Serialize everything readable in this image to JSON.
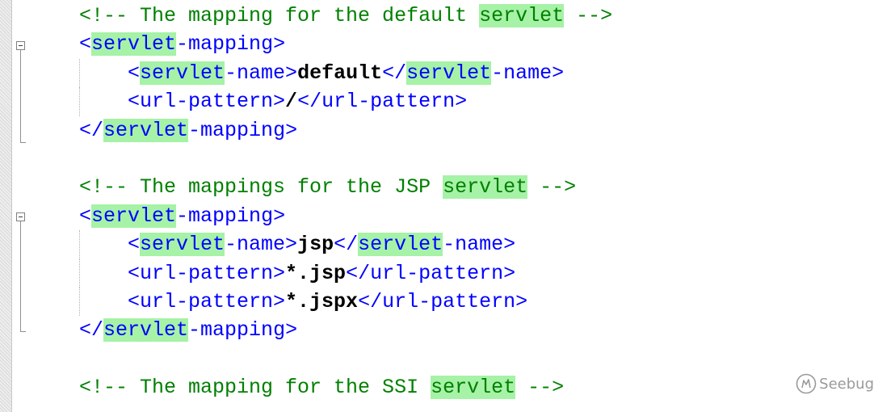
{
  "editor": {
    "lines": [
      [
        {
          "c": "comment",
          "t": "<!-- The mapping for the default "
        },
        {
          "c": "comment hl",
          "t": "servlet"
        },
        {
          "c": "comment",
          "t": " -->"
        }
      ],
      [
        {
          "c": "tag",
          "t": "<"
        },
        {
          "c": "tag hl",
          "t": "servlet"
        },
        {
          "c": "tag",
          "t": "-mapping>"
        }
      ],
      [
        {
          "c": "tag",
          "t": "    <"
        },
        {
          "c": "tag hl",
          "t": "servlet"
        },
        {
          "c": "tag",
          "t": "-name>"
        },
        {
          "c": "val",
          "t": "default"
        },
        {
          "c": "tag",
          "t": "</"
        },
        {
          "c": "tag hl",
          "t": "servlet"
        },
        {
          "c": "tag",
          "t": "-name>"
        }
      ],
      [
        {
          "c": "tag",
          "t": "    <url-pattern>"
        },
        {
          "c": "val",
          "t": "/"
        },
        {
          "c": "tag",
          "t": "</url-pattern>"
        }
      ],
      [
        {
          "c": "tag",
          "t": "</"
        },
        {
          "c": "tag hl",
          "t": "servlet"
        },
        {
          "c": "tag",
          "t": "-mapping>"
        }
      ],
      [],
      [
        {
          "c": "comment",
          "t": "<!-- The mappings for the JSP "
        },
        {
          "c": "comment hl",
          "t": "servlet"
        },
        {
          "c": "comment",
          "t": " -->"
        }
      ],
      [
        {
          "c": "tag",
          "t": "<"
        },
        {
          "c": "tag hl",
          "t": "servlet"
        },
        {
          "c": "tag",
          "t": "-mapping>"
        }
      ],
      [
        {
          "c": "tag",
          "t": "    <"
        },
        {
          "c": "tag hl",
          "t": "servlet"
        },
        {
          "c": "tag",
          "t": "-name>"
        },
        {
          "c": "val",
          "t": "jsp"
        },
        {
          "c": "tag",
          "t": "</"
        },
        {
          "c": "tag hl",
          "t": "servlet"
        },
        {
          "c": "tag",
          "t": "-name>"
        }
      ],
      [
        {
          "c": "tag",
          "t": "    <url-pattern>"
        },
        {
          "c": "val",
          "t": "*.jsp"
        },
        {
          "c": "tag",
          "t": "</url-pattern>"
        }
      ],
      [
        {
          "c": "tag",
          "t": "    <url-pattern>"
        },
        {
          "c": "val",
          "t": "*.jspx"
        },
        {
          "c": "tag",
          "t": "</url-pattern>"
        }
      ],
      [
        {
          "c": "tag",
          "t": "</"
        },
        {
          "c": "tag hl",
          "t": "servlet"
        },
        {
          "c": "tag",
          "t": "-mapping>"
        }
      ],
      [],
      [
        {
          "c": "comment",
          "t": "<!-- The mapping for the SSI "
        },
        {
          "c": "comment hl",
          "t": "servlet"
        },
        {
          "c": "comment",
          "t": " -->"
        }
      ]
    ]
  },
  "watermark": {
    "text": "Seebug",
    "icon": "seebug-logo-icon"
  },
  "colors": {
    "comment": "#008000",
    "tag": "#0000ff",
    "value": "#000000",
    "highlight": "#a6f2a6"
  }
}
